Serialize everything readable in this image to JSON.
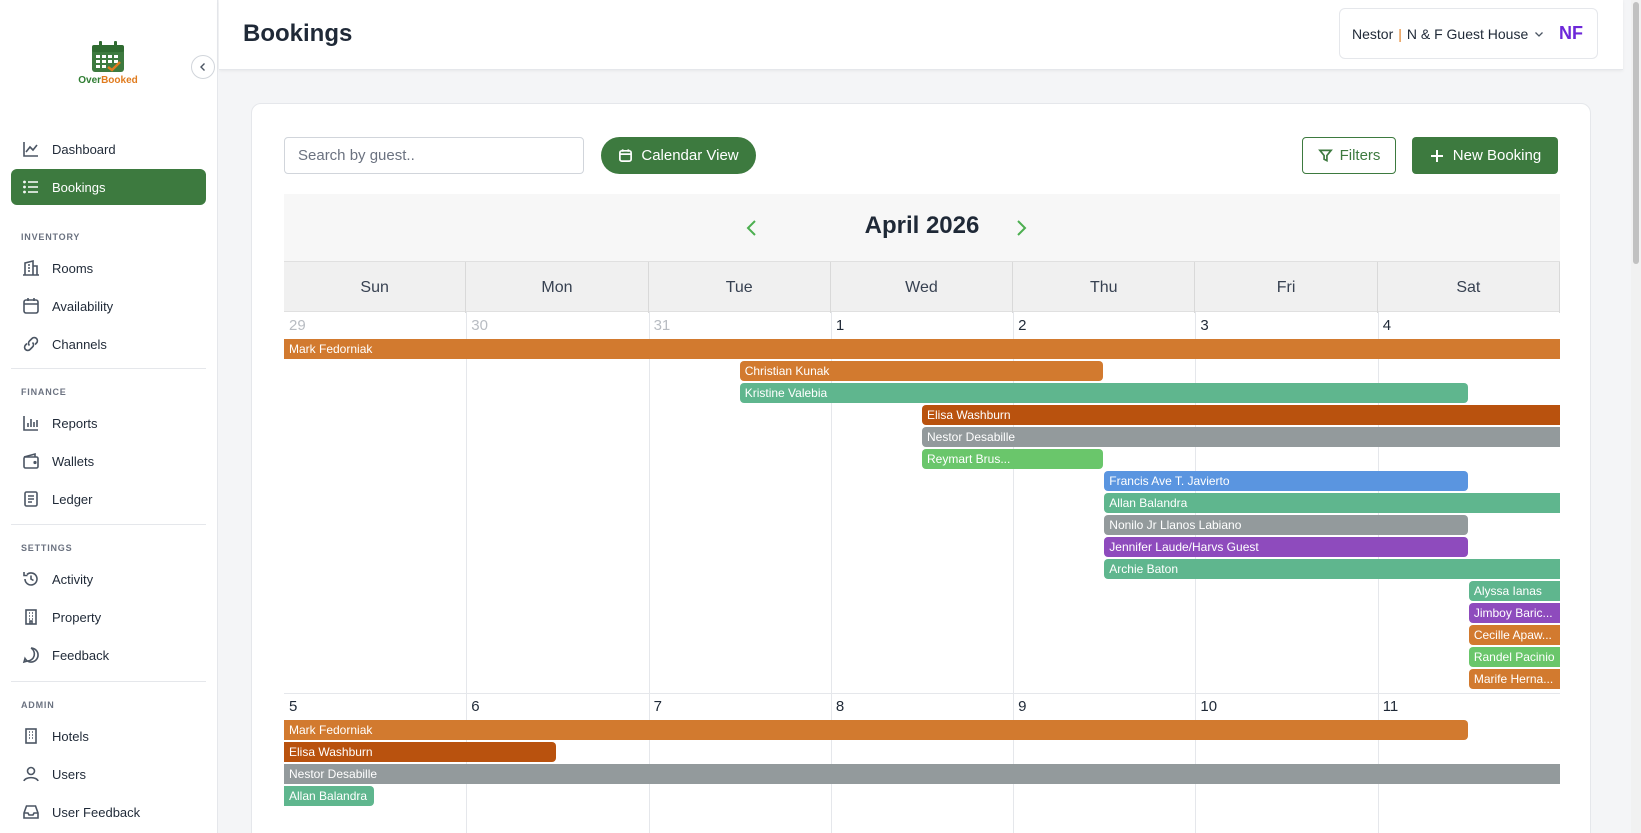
{
  "app": {
    "logo_over": "Over",
    "logo_booked": "Booked"
  },
  "header": {
    "title": "Bookings",
    "user_name": "Nestor",
    "separator": "|",
    "property": "N & F Guest House",
    "user_logo": "NF"
  },
  "sidebar": {
    "items": [
      {
        "label": "Dashboard",
        "icon": "chart-line-icon"
      },
      {
        "label": "Bookings",
        "icon": "list-icon"
      },
      {
        "label": "Rooms",
        "icon": "building-icon"
      },
      {
        "label": "Availability",
        "icon": "calendar-icon"
      },
      {
        "label": "Channels",
        "icon": "link-icon"
      },
      {
        "label": "Reports",
        "icon": "bar-chart-icon"
      },
      {
        "label": "Wallets",
        "icon": "wallet-icon"
      },
      {
        "label": "Ledger",
        "icon": "ledger-icon"
      },
      {
        "label": "Activity",
        "icon": "history-icon"
      },
      {
        "label": "Property",
        "icon": "building-icon"
      },
      {
        "label": "Feedback",
        "icon": "message-icon"
      },
      {
        "label": "Hotels",
        "icon": "hotel-icon"
      },
      {
        "label": "Users",
        "icon": "user-icon"
      },
      {
        "label": "User Feedback",
        "icon": "inbox-icon"
      }
    ],
    "sections": [
      "INVENTORY",
      "FINANCE",
      "SETTINGS",
      "ADMIN"
    ]
  },
  "toolbar": {
    "search_placeholder": "Search by guest..",
    "calendar_view": "Calendar View",
    "filters": "Filters",
    "new_booking": "New Booking"
  },
  "calendar": {
    "month": "April 2026",
    "weekdays": [
      "Sun",
      "Mon",
      "Tue",
      "Wed",
      "Thu",
      "Fri",
      "Sat"
    ],
    "week1_days": [
      "29",
      "30",
      "31",
      "1",
      "2",
      "3",
      "4"
    ],
    "week2_days": [
      "5",
      "6",
      "7",
      "8",
      "9",
      "10",
      "11"
    ],
    "events_week1": [
      {
        "name": "Mark Fedorniak",
        "color": "#d27a2f",
        "from": 0,
        "to": 7,
        "row": 0
      },
      {
        "name": "Christian Kunak",
        "color": "#d27a2f",
        "from": 2.5,
        "to": 4.5,
        "row": 1
      },
      {
        "name": "Kristine Valebia",
        "color": "#5fb68e",
        "from": 2.5,
        "to": 6.5,
        "row": 2
      },
      {
        "name": "Elisa Washburn",
        "color": "#b9520e",
        "from": 3.5,
        "to": 7,
        "row": 3
      },
      {
        "name": "Nestor Desabille",
        "color": "#939a9c",
        "from": 3.5,
        "to": 7,
        "row": 4
      },
      {
        "name": "Reymart Brus...",
        "color": "#6ac66b",
        "from": 3.5,
        "to": 4.5,
        "row": 5
      },
      {
        "name": "Francis Ave T. Javierto",
        "color": "#5a95e0",
        "from": 4.5,
        "to": 6.5,
        "row": 6
      },
      {
        "name": "Allan Balandra",
        "color": "#5fb68e",
        "from": 4.5,
        "to": 7,
        "row": 7
      },
      {
        "name": "Nonilo Jr Llanos Labiano",
        "color": "#939a9c",
        "from": 4.5,
        "to": 6.5,
        "row": 8
      },
      {
        "name": "Jennifer Laude/Harvs Guest",
        "color": "#8e4bbd",
        "from": 4.5,
        "to": 6.5,
        "row": 9
      },
      {
        "name": "Archie Baton",
        "color": "#5fb68e",
        "from": 4.5,
        "to": 7,
        "row": 10
      },
      {
        "name": "Alyssa Ianas",
        "color": "#5fb68e",
        "from": 6.5,
        "to": 7,
        "row": 11
      },
      {
        "name": "Jimboy Baric...",
        "color": "#8e4bbd",
        "from": 6.5,
        "to": 7,
        "row": 12
      },
      {
        "name": "Cecille Apaw...",
        "color": "#d27a2f",
        "from": 6.5,
        "to": 7,
        "row": 13
      },
      {
        "name": "Randel Pacinio",
        "color": "#6ac66b",
        "from": 6.5,
        "to": 7,
        "row": 14
      },
      {
        "name": "Marife Herna...",
        "color": "#d27a2f",
        "from": 6.5,
        "to": 7,
        "row": 15
      }
    ],
    "events_week2": [
      {
        "name": "Mark Fedorniak",
        "color": "#d27a2f",
        "from": 0,
        "to": 6.5,
        "row": 0
      },
      {
        "name": "Elisa Washburn",
        "color": "#b9520e",
        "from": 0,
        "to": 1.5,
        "row": 1
      },
      {
        "name": "Nestor Desabille",
        "color": "#939a9c",
        "from": 0,
        "to": 7,
        "row": 2
      },
      {
        "name": "Allan Balandra",
        "color": "#5fb68e",
        "from": 0,
        "to": 0.5,
        "row": 3
      }
    ]
  }
}
